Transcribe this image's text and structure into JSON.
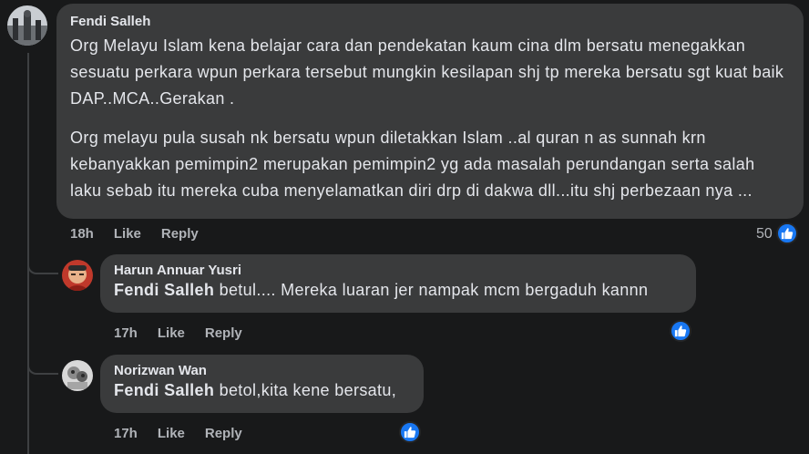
{
  "comments": [
    {
      "author": "Fendi Salleh",
      "paragraphs": [
        "Org Melayu Islam kena belajar cara dan pendekatan kaum cina dlm bersatu menegakkan sesuatu perkara wpun perkara tersebut mungkin kesilapan shj tp mereka bersatu sgt kuat baik DAP..MCA..Gerakan .",
        "Org melayu pula susah nk bersatu wpun diletakkan Islam ..al quran n as sunnah krn kebanyakkan pemimpin2 merupakan pemimpin2 yg ada masalah perundangan serta salah laku sebab itu mereka cuba menyelamatkan diri drp di dakwa dll...itu shj perbezaan nya ..."
      ],
      "time": "18h",
      "like_label": "Like",
      "reply_label": "Reply",
      "reaction_count": "50"
    },
    {
      "author": "Harun Annuar Yusri",
      "mention": "Fendi Salleh",
      "text": " betul.... Mereka luaran jer nampak mcm bergaduh kannn",
      "time": "17h",
      "like_label": "Like",
      "reply_label": "Reply"
    },
    {
      "author": "Norizwan Wan",
      "mention": "Fendi Salleh",
      "text": " betol,kita kene bersatu,",
      "time": "17h",
      "like_label": "Like",
      "reply_label": "Reply"
    }
  ],
  "colors": {
    "background": "#18191a",
    "bubble": "#3a3b3c",
    "meta_text": "#b0b3b8",
    "like_blue": "#1877f2"
  },
  "icons": {
    "reaction": "thumbs-up-icon"
  }
}
